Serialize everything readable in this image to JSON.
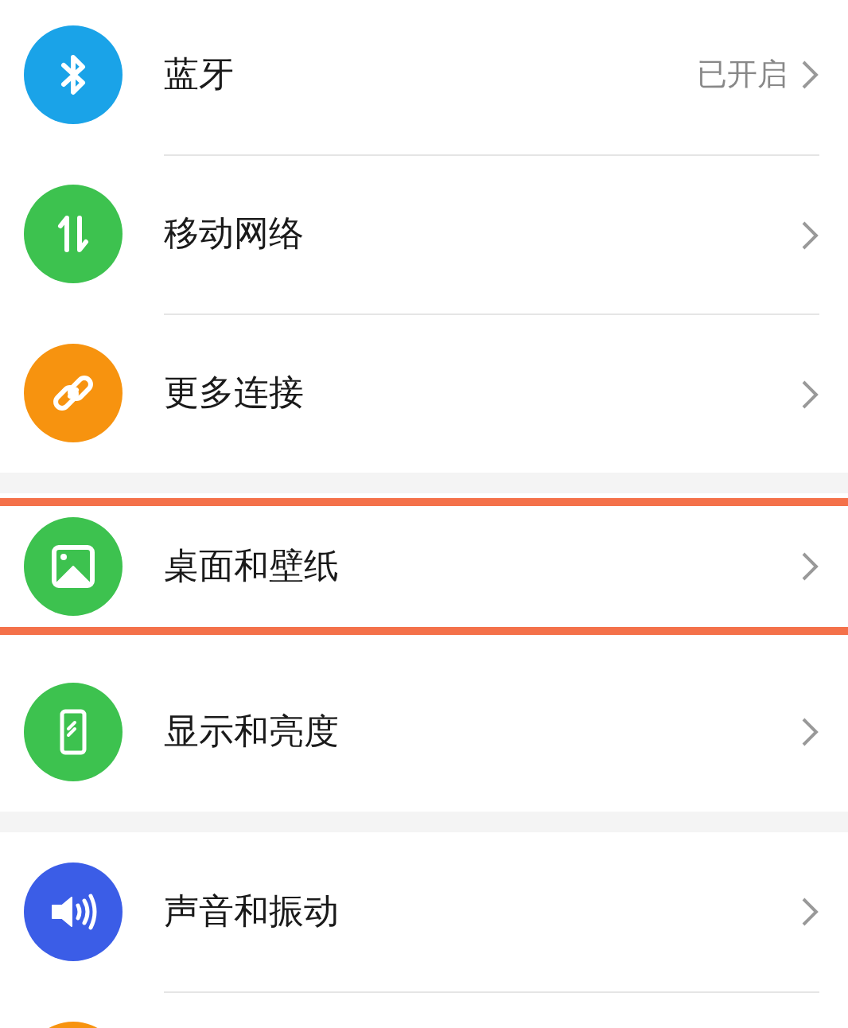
{
  "groups": [
    {
      "items": [
        {
          "kind": "bluetooth",
          "color": "#1aa3e8",
          "label": "蓝牙",
          "value": "已开启",
          "highlighted": false
        },
        {
          "kind": "network",
          "color": "#3dc24f",
          "label": "移动网络",
          "highlighted": false
        },
        {
          "kind": "link",
          "color": "#f7930f",
          "label": "更多连接",
          "highlighted": false
        }
      ]
    },
    {
      "items": [
        {
          "kind": "picture",
          "color": "#3dc24f",
          "label": "桌面和壁纸",
          "highlighted": true
        },
        {
          "kind": "phone",
          "color": "#3dc24f",
          "label": "显示和亮度",
          "highlighted": false
        }
      ]
    },
    {
      "items": [
        {
          "kind": "speaker",
          "color": "#3b5de7",
          "label": "声音和振动",
          "highlighted": false
        },
        {
          "kind": "partial",
          "color": "#f7930f",
          "highlighted": false
        }
      ]
    }
  ]
}
